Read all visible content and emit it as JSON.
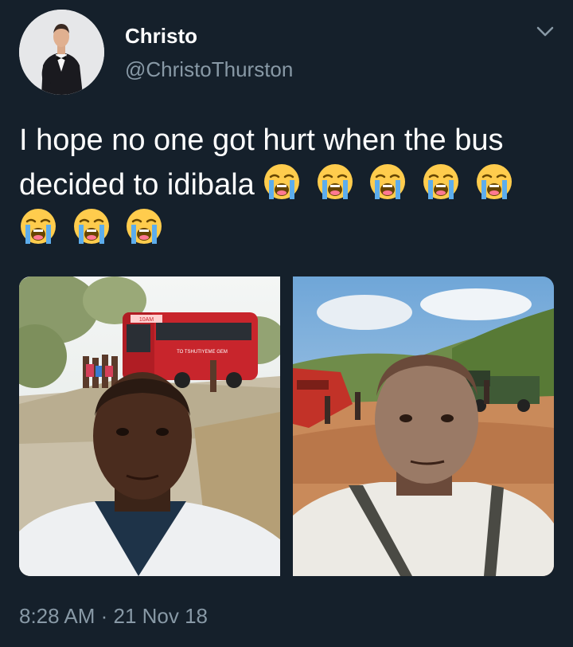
{
  "author": {
    "display_name": "Christo",
    "handle": "@ChristoThurston"
  },
  "tweet": {
    "text": "I hope no one got hurt when the bus decided to idibala",
    "emoji": "loudly-crying-face",
    "emoji_count": 8,
    "timestamp": "8:28 AM · 21 Nov 18"
  },
  "media": {
    "bus_sign": "10AM",
    "bus_side_text": "TO TSHUTIYEME GEM"
  },
  "colors": {
    "background": "#15202b",
    "text_primary": "#ffffff",
    "text_secondary": "#8899a6"
  },
  "icons": {
    "menu": "chevron-down-icon",
    "emoji": "loudly-crying-face-icon"
  }
}
